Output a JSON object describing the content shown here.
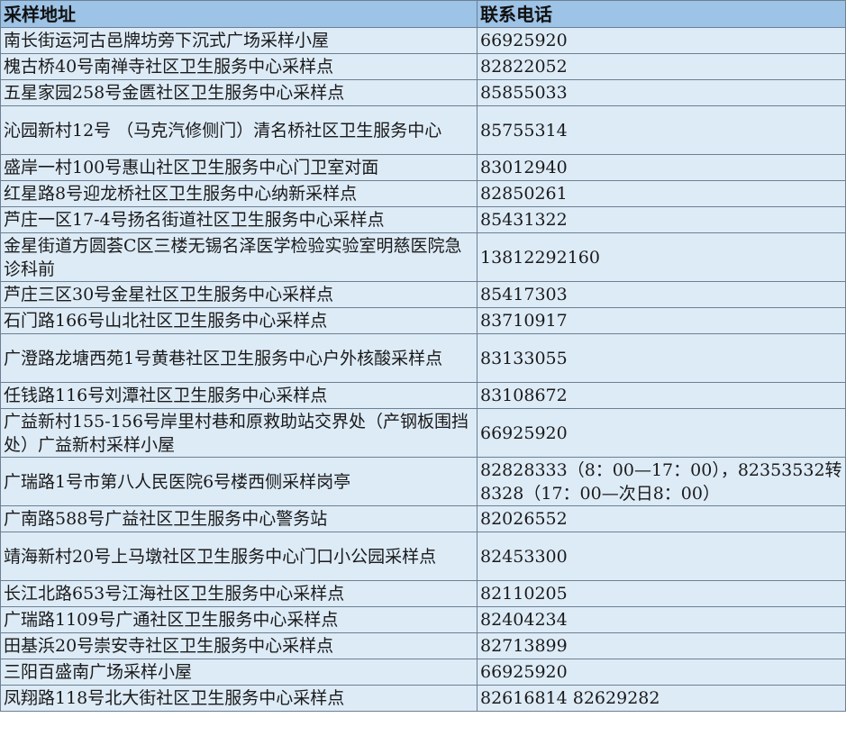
{
  "table": {
    "headers": [
      "采样地址",
      "联系电话"
    ],
    "rows": [
      {
        "address": "南长街运河古邑牌坊旁下沉式广场采样小屋",
        "phone": "66925920"
      },
      {
        "address": "槐古桥40号南禅寺社区卫生服务中心采样点",
        "phone": "82822052"
      },
      {
        "address": "五星家园258号金匮社区卫生服务中心采样点",
        "phone": "85855033"
      },
      {
        "address": "沁园新村12号 （马克汽修侧门）清名桥社区卫生服务中心",
        "phone": "85755314"
      },
      {
        "address": "盛岸一村100号惠山社区卫生服务中心门卫室对面",
        "phone": "83012940"
      },
      {
        "address": "红星路8号迎龙桥社区卫生服务中心纳新采样点",
        "phone": "82850261"
      },
      {
        "address": "芦庄一区17-4号扬名街道社区卫生服务中心采样点",
        "phone": "85431322"
      },
      {
        "address": "金星街道方圆荟C区三楼无锡名泽医学检验实验室明慈医院急诊科前",
        "phone": "13812292160"
      },
      {
        "address": "芦庄三区30号金星社区卫生服务中心采样点",
        "phone": "85417303"
      },
      {
        "address": "石门路166号山北社区卫生服务中心采样点",
        "phone": "83710917"
      },
      {
        "address": "广澄路龙塘西苑1号黄巷社区卫生服务中心户外核酸采样点",
        "phone": "83133055"
      },
      {
        "address": "任钱路116号刘潭社区卫生服务中心采样点",
        "phone": "83108672"
      },
      {
        "address": "广益新村155-156号岸里村巷和原救助站交界处（产钢板围挡处）广益新村采样小屋",
        "phone": "66925920"
      },
      {
        "address": "广瑞路1号市第八人民医院6号楼西侧采样岗亭",
        "phone": "82828333（8：00—17：00），82353532转8328（17：00—次日8：00）"
      },
      {
        "address": "广南路588号广益社区卫生服务中心警务站",
        "phone": "82026552"
      },
      {
        "address": "靖海新村20号上马墩社区卫生服务中心门口小公园采样点",
        "phone": "82453300"
      },
      {
        "address": "长江北路653号江海社区卫生服务中心采样点",
        "phone": "82110205"
      },
      {
        "address": "广瑞路1109号广通社区卫生服务中心采样点",
        "phone": "82404234"
      },
      {
        "address": "田基浜20号崇安寺社区卫生服务中心采样点",
        "phone": "82713899"
      },
      {
        "address": "三阳百盛南广场采样小屋",
        "phone": "66925920"
      },
      {
        "address": "凤翔路118号北大街社区卫生服务中心采样点",
        "phone": "82616814 82629282"
      }
    ]
  }
}
